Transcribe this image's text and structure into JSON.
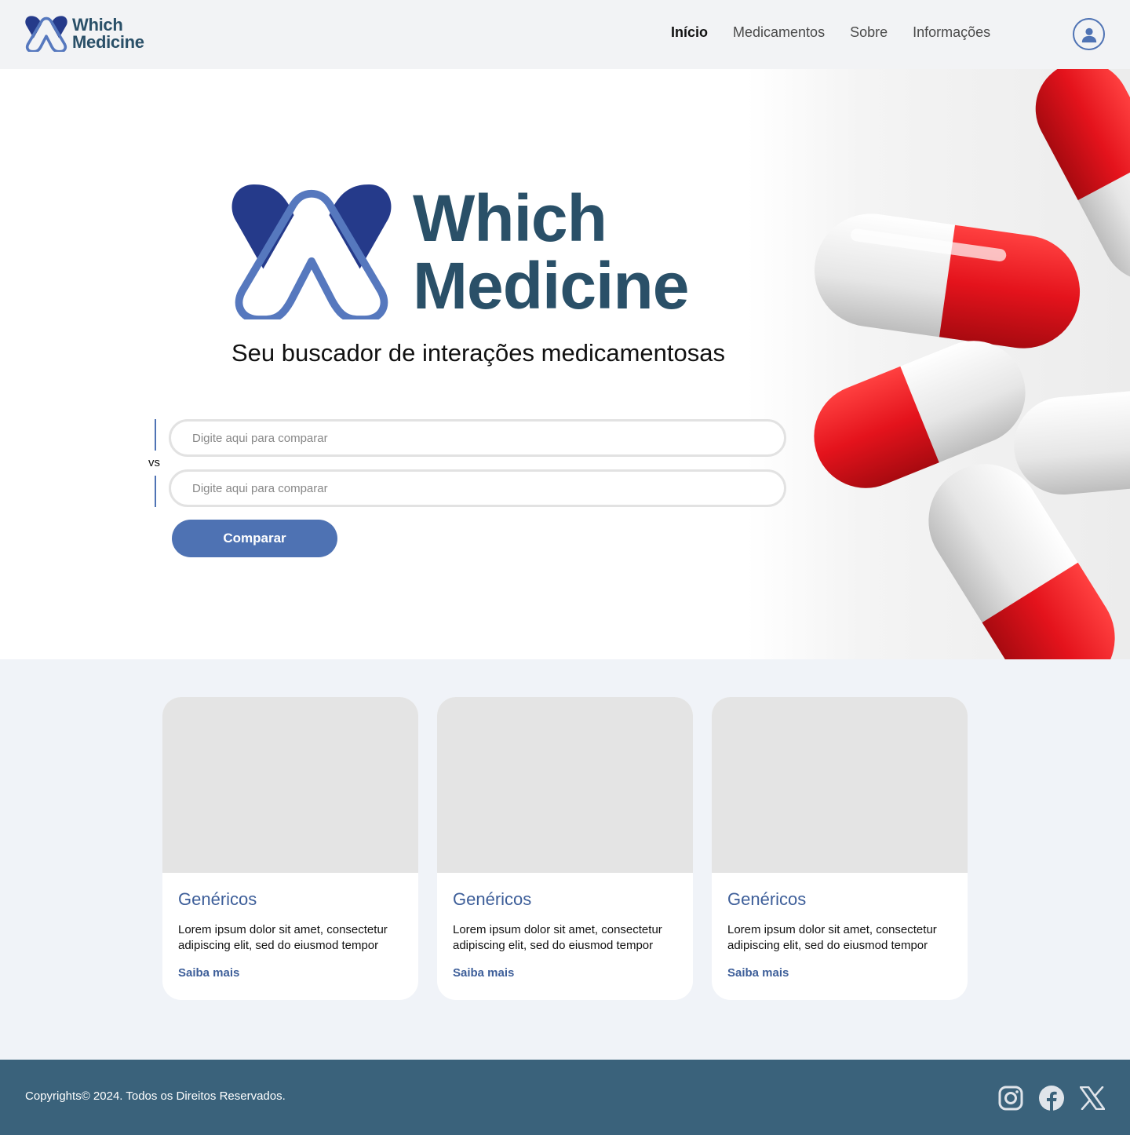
{
  "brand": {
    "line1": "Which",
    "line2": "Medicine"
  },
  "nav": {
    "items": [
      {
        "label": "Início",
        "active": true
      },
      {
        "label": "Medicamentos",
        "active": false
      },
      {
        "label": "Sobre",
        "active": false
      },
      {
        "label": "Informações",
        "active": false
      }
    ],
    "user_icon": "user-circle-icon"
  },
  "hero": {
    "logo_line1": "Which",
    "logo_line2": "Medicine",
    "tagline": "Seu buscador de interações medicamentosas",
    "vs_label": "vs",
    "input1_placeholder": "Digite aqui para comparar",
    "input2_placeholder": "Digite aqui para comparar",
    "compare_button": "Comparar",
    "image": "red-white-capsules"
  },
  "cards": [
    {
      "title": "Genéricos",
      "text": "Lorem ipsum dolor sit amet, consectetur adipiscing elit, sed do eiusmod tempor",
      "link": "Saiba mais"
    },
    {
      "title": "Genéricos",
      "text": "Lorem ipsum dolor sit amet, consectetur adipiscing elit, sed do eiusmod tempor",
      "link": "Saiba mais"
    },
    {
      "title": "Genéricos",
      "text": "Lorem ipsum dolor sit amet, consectetur adipiscing elit, sed do eiusmod tempor",
      "link": "Saiba mais"
    }
  ],
  "footer": {
    "copyright": "Copyrights© 2024. Todos os Direitos Reservados.",
    "social": [
      "instagram-icon",
      "facebook-icon",
      "x-icon"
    ]
  },
  "colors": {
    "brand_dark": "#2a5068",
    "brand_blue": "#4e72b3",
    "logo_navy": "#253a8a",
    "footer_bg": "#3a627b",
    "capsule_red": "#e4131c"
  }
}
